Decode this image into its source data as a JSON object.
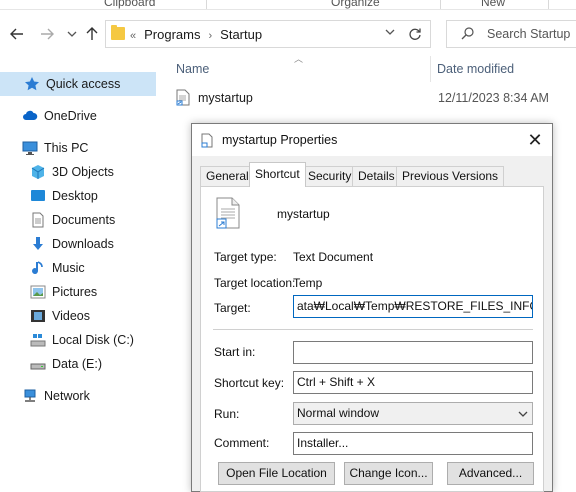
{
  "ribbon": {
    "groups": [
      "Clipboard",
      "Organize",
      "New"
    ]
  },
  "nav": {
    "back_icon": "arrow-left-icon",
    "forward_icon": "arrow-right-icon",
    "recent_icon": "chevron-down-icon",
    "up_icon": "arrow-up-icon",
    "address_prefix": "«",
    "path": [
      "Programs",
      "Startup"
    ],
    "refresh_icon": "refresh-icon",
    "search_placeholder": "Search Startup"
  },
  "sidebar": {
    "items": [
      {
        "label": "Quick access",
        "icon": "star-icon",
        "selected": true
      },
      {
        "label": "OneDrive",
        "icon": "cloud-icon"
      },
      {
        "label": "This PC",
        "icon": "computer-icon"
      },
      {
        "label": "3D Objects",
        "icon": "cube-icon"
      },
      {
        "label": "Desktop",
        "icon": "desktop-icon"
      },
      {
        "label": "Documents",
        "icon": "document-icon"
      },
      {
        "label": "Downloads",
        "icon": "download-icon"
      },
      {
        "label": "Music",
        "icon": "music-icon"
      },
      {
        "label": "Pictures",
        "icon": "picture-icon"
      },
      {
        "label": "Videos",
        "icon": "video-icon"
      },
      {
        "label": "Local Disk (C:)",
        "icon": "disk-icon"
      },
      {
        "label": "Data (E:)",
        "icon": "drive-icon"
      },
      {
        "label": "Network",
        "icon": "network-icon"
      }
    ]
  },
  "filelist": {
    "columns": [
      "Name",
      "Date modified"
    ],
    "rows": [
      {
        "name": "mystartup",
        "date": "12/11/2023 8:34 AM"
      }
    ]
  },
  "dialog": {
    "title": "mystartup Properties",
    "close_label": "✕",
    "tabs": [
      "General",
      "Shortcut",
      "Security",
      "Details",
      "Previous Versions"
    ],
    "active_tab": "Shortcut",
    "file_name": "mystartup",
    "target_type_label": "Target type:",
    "target_type": "Text Document",
    "target_location_label": "Target location:",
    "target_location": "Temp",
    "target_label": "Target:",
    "target_value": "ata₩Local₩Temp₩RESTORE_FILES_INFO.txt",
    "start_in_label": "Start in:",
    "start_in_value": "",
    "shortcut_key_label": "Shortcut key:",
    "shortcut_key_value": "Ctrl + Shift + X",
    "run_label": "Run:",
    "run_value": "Normal window",
    "comment_label": "Comment:",
    "comment_value": "Installer...",
    "buttons": {
      "open_location": "Open File Location",
      "change_icon": "Change Icon...",
      "advanced": "Advanced..."
    }
  }
}
